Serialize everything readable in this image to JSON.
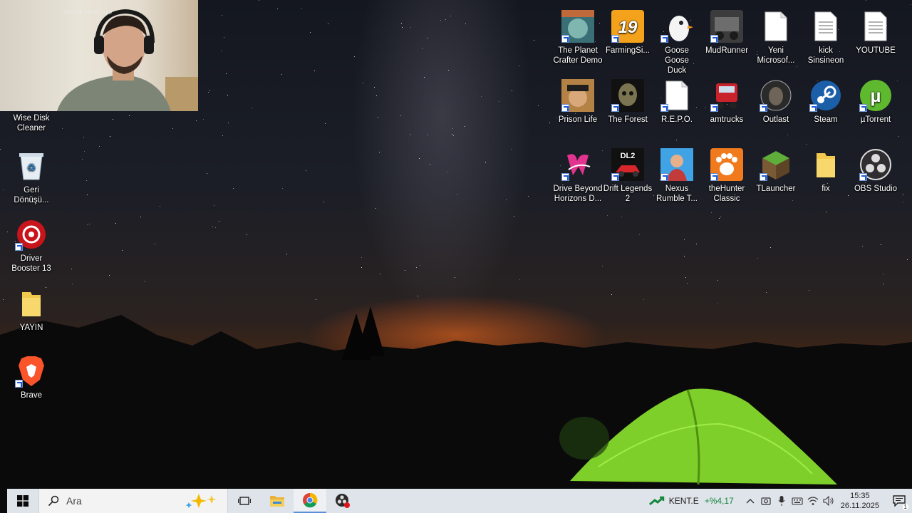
{
  "webcam": {
    "overlay_text": "selçuk.sezer.app"
  },
  "left_icons": [
    {
      "label_line1": "Wise Disk",
      "label_line2": "Cleaner",
      "icon": "wise-disk-cleaner-icon"
    },
    {
      "label_line1": "Geri",
      "label_line2": "Dönüşü...",
      "icon": "recycle-bin-icon"
    },
    {
      "label_line1": "Driver",
      "label_line2": "Booster 13",
      "icon": "driver-booster-icon"
    },
    {
      "label_line1": "YAYIN",
      "label_line2": "",
      "icon": "folder-icon"
    },
    {
      "label_line1": "Brave",
      "label_line2": "",
      "icon": "brave-icon"
    }
  ],
  "right_icons": {
    "row1": [
      {
        "label_line1": "The Planet",
        "label_line2": "Crafter Demo",
        "icon": "planet-crafter-icon"
      },
      {
        "label_line1": "FarmingSi...",
        "label_line2": "",
        "icon": "farming-simulator-icon",
        "badge": "19"
      },
      {
        "label_line1": "Goose Goose",
        "label_line2": "Duck",
        "icon": "goose-goose-duck-icon"
      },
      {
        "label_line1": "MudRunner",
        "label_line2": "",
        "icon": "mudrunner-icon"
      },
      {
        "label_line1": "Yeni",
        "label_line2": "Microsof...",
        "icon": "text-file-icon"
      },
      {
        "label_line1": "kick",
        "label_line2": "Sinsineon",
        "icon": "text-file-icon"
      },
      {
        "label_line1": "YOUTUBE",
        "label_line2": "",
        "icon": "text-file-icon"
      }
    ],
    "row2": [
      {
        "label_line1": "Prison Life",
        "label_line2": "",
        "icon": "prison-life-icon"
      },
      {
        "label_line1": "The Forest",
        "label_line2": "",
        "icon": "the-forest-icon"
      },
      {
        "label_line1": "R.E.P.O.",
        "label_line2": "",
        "icon": "blank-file-icon"
      },
      {
        "label_line1": "amtrucks",
        "label_line2": "",
        "icon": "american-truck-icon"
      },
      {
        "label_line1": "Outlast",
        "label_line2": "",
        "icon": "outlast-icon"
      },
      {
        "label_line1": "Steam",
        "label_line2": "",
        "icon": "steam-icon"
      },
      {
        "label_line1": "µTorrent",
        "label_line2": "",
        "icon": "utorrent-icon"
      }
    ],
    "row3": [
      {
        "label_line1": "Drive Beyond",
        "label_line2": "Horizons D...",
        "icon": "drive-beyond-horizons-icon"
      },
      {
        "label_line1": "Drift Legends",
        "label_line2": "2",
        "icon": "drift-legends-icon",
        "badge": "DL2"
      },
      {
        "label_line1": "Nexus",
        "label_line2": "Rumble T...",
        "icon": "nexus-rumble-icon"
      },
      {
        "label_line1": "theHunter",
        "label_line2": "Classic",
        "icon": "thehunter-icon"
      },
      {
        "label_line1": "TLauncher",
        "label_line2": "",
        "icon": "tlauncher-icon"
      },
      {
        "label_line1": "fix",
        "label_line2": "",
        "icon": "folder-icon"
      },
      {
        "label_line1": "OBS Studio",
        "label_line2": "",
        "icon": "obs-studio-icon"
      }
    ]
  },
  "taskbar": {
    "search_placeholder": "Ara",
    "stock_symbol": "KENT.E",
    "stock_change": "+%4,17",
    "time": "15:35",
    "date": "26.11.2025",
    "notification_count": "1"
  },
  "colors": {
    "taskbar_bg": "#dfe3ea",
    "stock_up": "#13883a",
    "tent_green": "#8ee03a"
  }
}
